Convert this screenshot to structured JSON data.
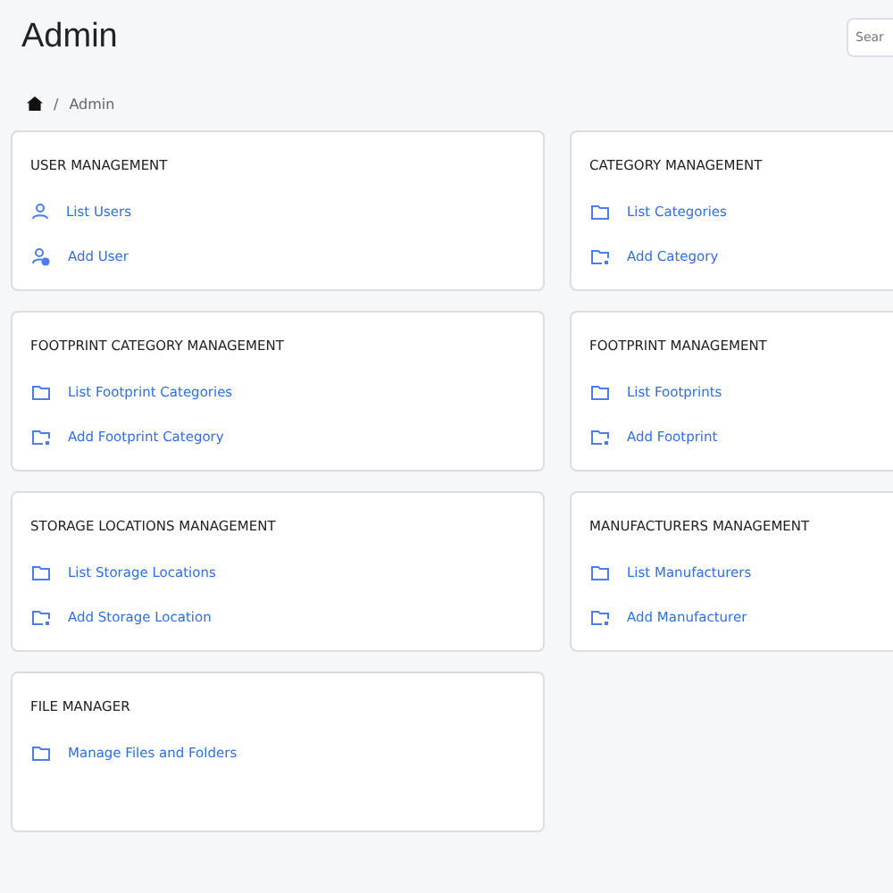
{
  "page": {
    "title": "Admin",
    "search": {
      "placeholder": "Sear"
    }
  },
  "breadcrumb": [
    {
      "kind": "home"
    },
    {
      "kind": "separator",
      "label": "/"
    },
    {
      "kind": "text",
      "label": "Admin"
    }
  ],
  "cards": [
    {
      "title": "USER MANAGEMENT",
      "links": [
        {
          "kind": "user",
          "label": "List Users"
        },
        {
          "kind": "user-add",
          "label": "Add User"
        }
      ]
    },
    {
      "title": "CATEGORY MANAGEMENT",
      "links": [
        {
          "kind": "folder",
          "label": "List Categories"
        },
        {
          "kind": "folder-add",
          "label": "Add Category"
        }
      ]
    },
    {
      "title": "FOOTPRINT CATEGORY MANAGEMENT",
      "links": [
        {
          "kind": "folder",
          "label": "List Footprint Categories"
        },
        {
          "kind": "folder-add",
          "label": "Add Footprint Category"
        }
      ]
    },
    {
      "title": "FOOTPRINT MANAGEMENT",
      "links": [
        {
          "kind": "folder",
          "label": "List Footprints"
        },
        {
          "kind": "folder-add",
          "label": "Add Footprint"
        }
      ]
    },
    {
      "title": "STORAGE LOCATIONS MANAGEMENT",
      "links": [
        {
          "kind": "folder",
          "label": "List Storage Locations"
        },
        {
          "kind": "folder-add",
          "label": "Add Storage Location"
        }
      ]
    },
    {
      "title": "MANUFACTURERS MANAGEMENT",
      "links": [
        {
          "kind": "folder",
          "label": "List Manufacturers"
        },
        {
          "kind": "folder-add",
          "label": "Add Manufacturer"
        }
      ]
    },
    {
      "title": "FILE MANAGER",
      "links": [
        {
          "kind": "folder",
          "label": "Manage Files and Folders"
        }
      ]
    }
  ]
}
